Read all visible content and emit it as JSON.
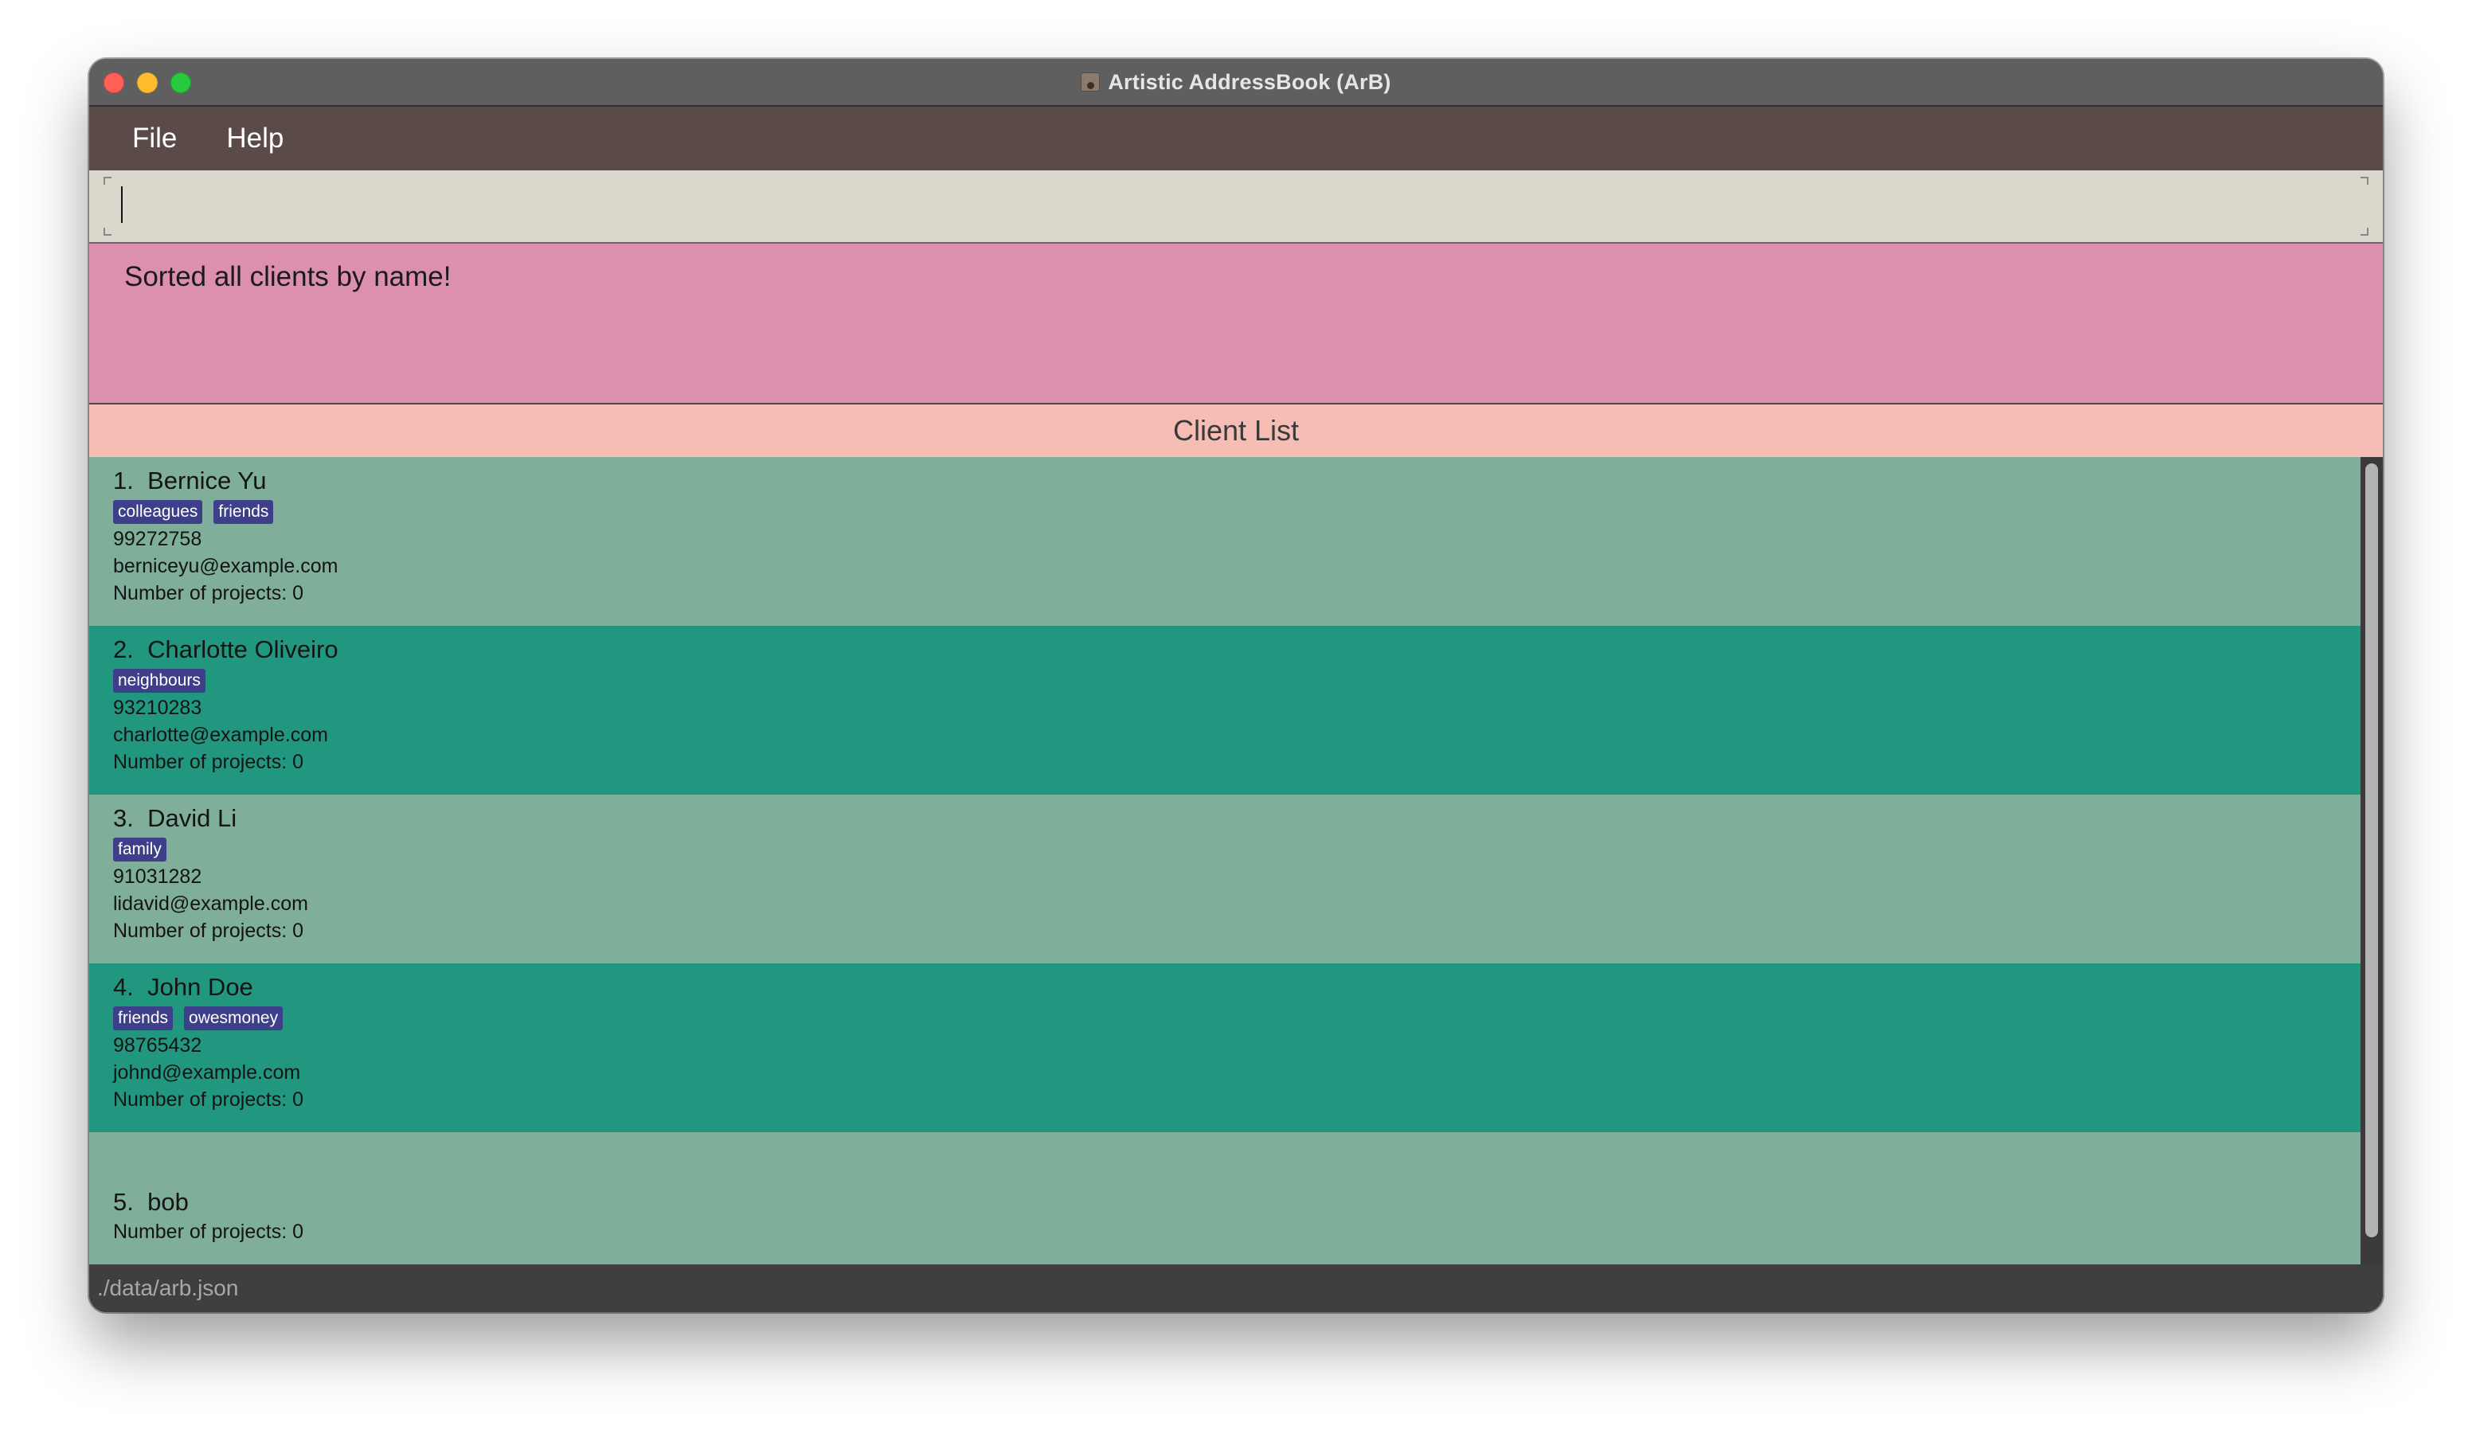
{
  "window": {
    "title": "Artistic AddressBook (ArB)",
    "app_icon": "contact-card-icon"
  },
  "menu": {
    "items": [
      {
        "label": "File"
      },
      {
        "label": "Help"
      }
    ]
  },
  "command": {
    "value": "",
    "placeholder": ""
  },
  "result": {
    "message": "Sorted all clients by name!"
  },
  "client_list": {
    "title": "Client List",
    "clients": [
      {
        "index": "1.",
        "name": "Bernice Yu",
        "tags": [
          "colleagues",
          "friends"
        ],
        "phone": "99272758",
        "email": "berniceyu@example.com",
        "projects": "Number of projects: 0"
      },
      {
        "index": "2.",
        "name": "Charlotte Oliveiro",
        "tags": [
          "neighbours"
        ],
        "phone": "93210283",
        "email": "charlotte@example.com",
        "projects": "Number of projects: 0"
      },
      {
        "index": "3.",
        "name": "David Li",
        "tags": [
          "family"
        ],
        "phone": "91031282",
        "email": "lidavid@example.com",
        "projects": "Number of projects: 0"
      },
      {
        "index": "4.",
        "name": "John Doe",
        "tags": [
          "friends",
          "owesmoney"
        ],
        "phone": "98765432",
        "email": "johnd@example.com",
        "projects": "Number of projects: 0"
      },
      {
        "index": "5.",
        "name": "bob",
        "tags": [],
        "phone": "",
        "email": "",
        "projects": "Number of projects: 0"
      }
    ]
  },
  "status": {
    "file_path": "./data/arb.json"
  },
  "colors": {
    "menubar": "#5a4b48",
    "command_box": "#dad7cc",
    "result_box": "#dd90ae",
    "list_header": "#f5bdb3",
    "card_light": "#7fae9b",
    "card_dark": "#22977f",
    "tag": "#3e3f8a"
  }
}
